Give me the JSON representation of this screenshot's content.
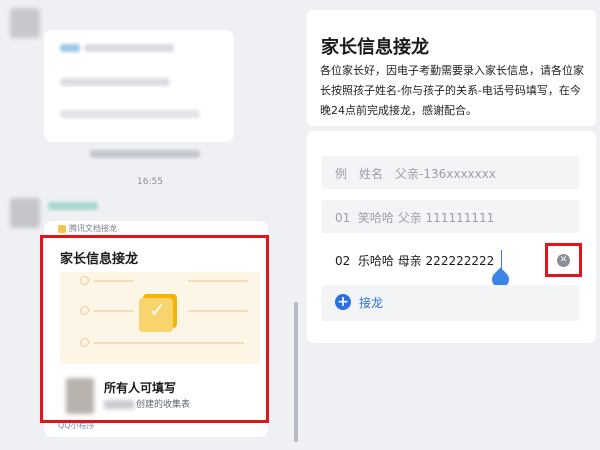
{
  "colors": {
    "highlight": "#e0151b",
    "accent_blue": "#2b6fe0",
    "banner": "#fdf5e6",
    "doc_yellow": "#f5b400"
  },
  "chat": {
    "timestamp": "16:55",
    "mini_app_card": {
      "header_label": "腾讯文档接龙",
      "title": "家长信息接龙",
      "banner_icon": "checkmark-document-icon",
      "form_name": "所有人可填写",
      "form_desc_suffix": "创建的收集表",
      "footer_label": "QQ小程序"
    }
  },
  "form": {
    "title": "家长信息接龙",
    "description": "各位家长好，因电子考勤需要录入家长信息，请各位家长按照孩子姓名-你与孩子的关系-电话号码填写，在今晚24点前完成接龙，感谢配合。",
    "example_row": "例　姓名　父亲-136xxxxxxx",
    "entries": [
      {
        "number": "01",
        "text": "笑哈哈 父亲 111111111"
      },
      {
        "number": "02",
        "text": "乐哈哈 母亲 222222222"
      }
    ],
    "add_label": "接龙",
    "clear_icon": "clear-circle-icon"
  }
}
